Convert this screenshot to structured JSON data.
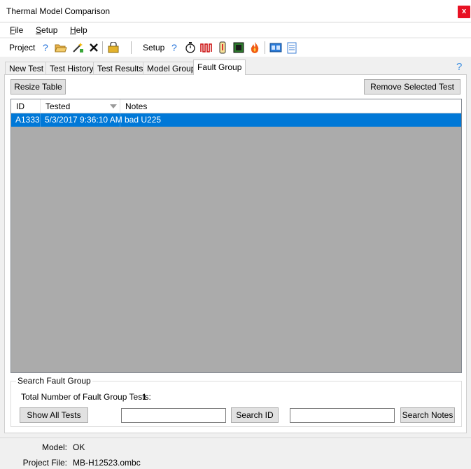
{
  "window": {
    "title": "Thermal Model Comparison",
    "close_label": "x"
  },
  "menu": {
    "file": "File",
    "setup": "Setup",
    "help": "Help"
  },
  "toolbar": {
    "project_label": "Project",
    "setup_label": "Setup",
    "icons": [
      "help-icon",
      "open-folder-icon",
      "magic-wand-icon",
      "close-x-icon",
      "lock-key-icon",
      "help-icon",
      "stopwatch-icon",
      "waveform-icon",
      "thermometer-icon",
      "chip-icon",
      "flame-icon",
      "panel-icon",
      "notepad-icon"
    ]
  },
  "tabs": [
    "New Test",
    "Test History",
    "Test Results",
    "Model Group",
    "Fault Group"
  ],
  "active_tab": "Fault Group",
  "buttons": {
    "resize_table": "Resize Table",
    "remove_selected": "Remove Selected Test",
    "show_all": "Show All Tests",
    "search_id": "Search ID",
    "search_notes": "Search Notes"
  },
  "table": {
    "columns": [
      "ID",
      "Tested",
      "Notes"
    ],
    "rows": [
      {
        "id": "A1333",
        "tested": "5/3/2017 9:36:10 AM",
        "notes": "bad U225"
      }
    ]
  },
  "search": {
    "group_title": "Search Fault Group",
    "total_label": "Total Number of Fault Group Tests:",
    "total_value": "1",
    "id_value": "",
    "notes_value": ""
  },
  "status": {
    "model_label": "Model:",
    "model_value": "OK",
    "project_label": "Project File:",
    "project_value": "MB-H12523.ombc"
  },
  "colors": {
    "selection": "#0078d7",
    "close": "#e81123",
    "grid_bg": "#ababab"
  }
}
